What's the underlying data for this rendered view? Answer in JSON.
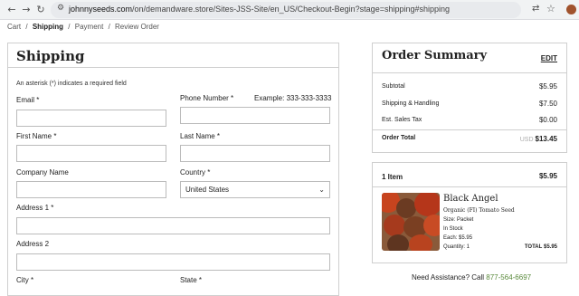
{
  "browser": {
    "url_host": "johnnyseeds.com",
    "url_path": "/on/demandware.store/Sites-JSS-Site/en_US/Checkout-Begin?stage=shipping#shipping"
  },
  "breadcrumb": {
    "items": [
      "Cart",
      "/",
      "Shipping",
      "/",
      "Payment",
      "/",
      "Review Order"
    ]
  },
  "shipping": {
    "title": "Shipping",
    "required_note": "An asterisk (*) indicates a required field",
    "email_label": "Email *",
    "phone_label": "Phone Number  *",
    "phone_hint": "Example: 333-333-3333",
    "first_name_label": "First Name *",
    "last_name_label": "Last Name *",
    "company_label": "Company Name",
    "country_label": "Country  *",
    "country_value": "United States",
    "address1_label": "Address 1 *",
    "address2_label": "Address 2",
    "city_label": "City *",
    "state_label": "State *"
  },
  "summary": {
    "title": "Order Summary",
    "edit_label": "EDIT",
    "subtotal_label": "Subtotal",
    "subtotal_value": "$5.95",
    "shipping_label": "Shipping & Handling",
    "shipping_value": "$7.50",
    "tax_label": "Est. Sales Tax",
    "tax_value": "$0.00",
    "total_label": "Order Total",
    "total_currency": "USD",
    "total_value": "$13.45"
  },
  "items": {
    "count_label": "1 Item",
    "price": "$5.95",
    "product_name": "Black Angel",
    "product_subtitle": "Organic (FI) Tomato Seed",
    "size": "Size: Packet",
    "stock": "In Stock",
    "each": "Each: $5.95",
    "quantity": "Quantity: 1",
    "total_label": "TOTAL",
    "total_value": "$5.95"
  },
  "assistance": {
    "text": "Need Assistance? Call",
    "phone": "877-564-6697"
  },
  "colors": {
    "phone_link": "#5a8a3c",
    "border": "#cfcfcf"
  }
}
